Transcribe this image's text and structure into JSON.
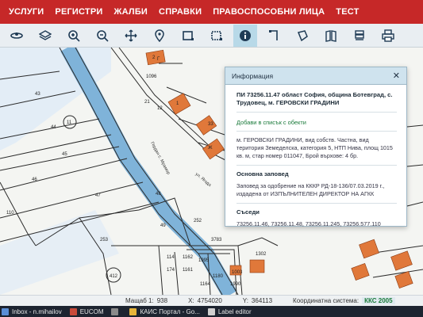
{
  "nav": {
    "items": [
      "УСЛУГИ",
      "РЕГИСТРИ",
      "ЖАЛБИ",
      "СПРАВКИ",
      "ПРАВОСПОСОБНИ ЛИЦА",
      "ТЕСТ"
    ]
  },
  "toolbar": {
    "tools": [
      "globe-icon",
      "layers-icon",
      "zoom-in-icon",
      "zoom-out-icon",
      "pan-icon",
      "location-pin-icon",
      "select-rectangle-icon",
      "select-edit-icon",
      "info-icon",
      "measure-icon",
      "shape-icon",
      "book-icon",
      "layers-stack-icon",
      "print-icon"
    ],
    "active": "info-icon"
  },
  "map": {
    "parcel_labels": [
      "43",
      "44",
      "11",
      "45",
      "46",
      "47",
      "48",
      "49",
      "253",
      "110",
      "252",
      "412",
      "114",
      "174",
      "1162",
      "1161",
      "1995",
      "1164",
      "1180",
      "1096",
      "12",
      "21",
      "33",
      "3783",
      "1302",
      "1003",
      "1990",
      "2",
      "1",
      "Г",
      "Ж"
    ],
    "street_labels": [
      "Гердан с. Мрамор",
      "ул. Ягода"
    ]
  },
  "info_popup": {
    "header": "Информация",
    "title": "ПИ 73256.11.47 област София, община Ботевград, с. Трудовец, м. ГЕРОВСКИ ГРАДИНИ",
    "add_link": "Добави в списък с обекти",
    "description": "м. ГЕРОВСКИ ГРАДИНИ, вид собств. Частна, вид територия Земеделска, категория 5, НТП Нива, площ 1015 кв. м, стар номер 011047, Брой върхове: 4 бр.",
    "order_heading": "Основна заповед",
    "order_text": "Заповед за одобрение на КККР РД-18-136/07.03.2019 г., издадена от ИЗПЪЛНИТЕЛЕН ДИРЕКТОР НА АГКК",
    "neighbours_heading": "Съседи",
    "neighbours": "73256.11.46, 73256.11.48, 73256.11.245, 73256.577.110"
  },
  "status": {
    "scale_label": "Мащаб 1:",
    "scale_value": "938",
    "x_label": "X:",
    "x_value": "4754020",
    "y_label": "Y:",
    "y_value": "364113",
    "coord_label": "Координатна система:",
    "coord_value": "ККС 2005"
  },
  "taskbar": {
    "items": [
      "Inbox - n.mihailov",
      "EUCOM",
      "",
      "КАИС Портал - Go...",
      "Label editor"
    ]
  },
  "colors": {
    "nav_bg": "#c62828",
    "toolbar_bg": "#e9eef2",
    "building": "#e0783a",
    "road": "#7fb3d9",
    "parcel_line": "#2b2b2b",
    "link_green": "#1a7a3a"
  }
}
